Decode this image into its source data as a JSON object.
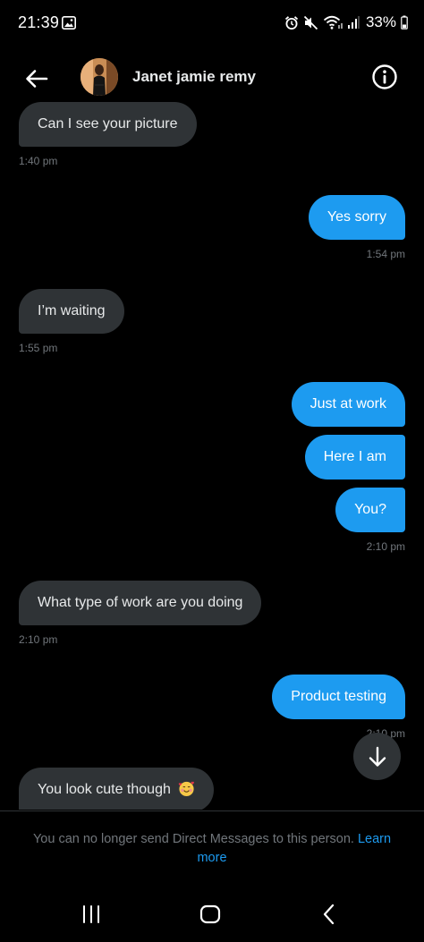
{
  "status_bar": {
    "time": "21:39",
    "battery": "33%"
  },
  "header": {
    "contact_name": "Janet jamie remy"
  },
  "messages": [
    {
      "text": "Can I see your picture",
      "time": "1:40 pm"
    },
    {
      "text": "Yes sorry",
      "time": "1:54 pm"
    },
    {
      "text": "I’m waiting",
      "time": "1:55 pm"
    },
    {
      "text": "Just at work"
    },
    {
      "text": "Here I am"
    },
    {
      "text": "You?",
      "time": "2:10 pm"
    },
    {
      "text": "What type of work are you doing",
      "time": "2:10 pm"
    },
    {
      "text": "Product testing",
      "time": "2:10 pm"
    },
    {
      "text": "You look cute though",
      "emoji": "smiling-face-with-hearts-icon"
    }
  ],
  "notice": {
    "text": "You can no longer send Direct Messages to this person.",
    "link": "Learn more"
  },
  "colors": {
    "background": "#000000",
    "incoming_bubble": "#2f3336",
    "outgoing_bubble": "#1d9bf0",
    "muted_text": "#71767b",
    "accent": "#1d9bf0"
  }
}
